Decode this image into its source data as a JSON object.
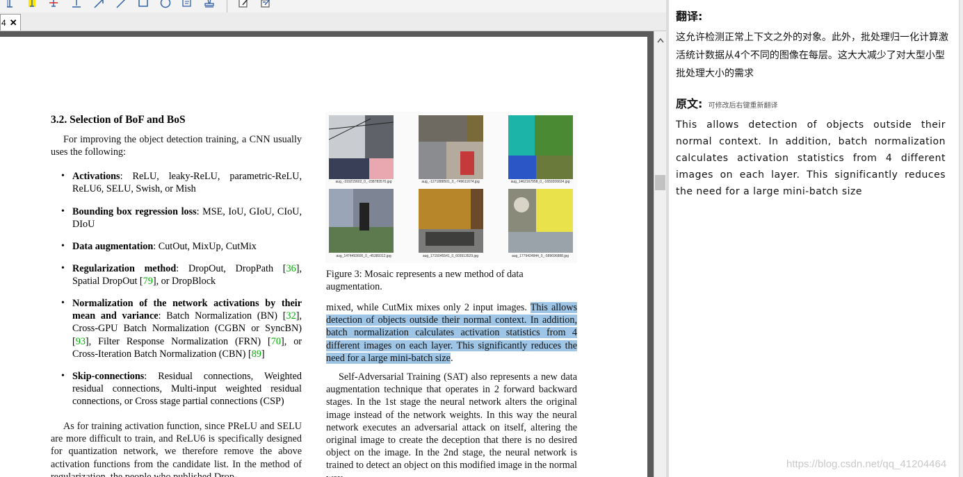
{
  "tab": {
    "label": "4",
    "close": "✕"
  },
  "doc": {
    "heading": "3.2. Selection of BoF and BoS",
    "intro": "For improving the object detection training, a CNN usually uses the following:",
    "bullets": [
      {
        "term": "Activations",
        "rest": ": ReLU, leaky-ReLU, parametric-ReLU, ReLU6, SELU, Swish, or Mish"
      },
      {
        "term": "Bounding box regression loss",
        "rest": ": MSE, IoU, GIoU, CIoU, DIoU"
      },
      {
        "term": "Data augmentation",
        "rest": ": CutOut, MixUp, CutMix"
      },
      {
        "term": "Regularization method",
        "rest_a": ": DropOut, DropPath [",
        "cite_a": "36",
        "rest_b": "], Spatial DropOut [",
        "cite_b": "79",
        "rest_c": "], or DropBlock"
      },
      {
        "term": "Normalization of the network activations by their mean and variance",
        "t1": ": Batch Normalization (BN) [",
        "c1": "32",
        "t2": "], Cross-GPU Batch Normalization (CGBN or SyncBN) [",
        "c2": "93",
        "t3": "], Filter Response Normalization (FRN) [",
        "c3": "70",
        "t4": "], or Cross-Iteration Batch Normalization (CBN) [",
        "c4": "89",
        "t5": "]"
      },
      {
        "term": "Skip-connections",
        "rest": ": Residual connections, Weighted residual connections, Multi-input weighted residual connections, or Cross stage partial connections (CSP)"
      }
    ],
    "training_para": "As for training activation function, since PReLU and SELU are more difficult to train, and ReLU6 is specifically designed for quantization network, we therefore remove the above activation functions from the candidate list. In the method of regularization, the people who published Drop-",
    "figure_caption": "Figure 3: Mosaic represents a new method of data augmentation.",
    "mosaic_captions": [
      "aug_-319215602_0_-238783570.jpg",
      "aug_-1271888501_0_-749611674.jpg",
      "aug_1462167958_0_-1659206634.jpg",
      "aug_1474493600_0_-45389312.jpg",
      "aug_1715045541_0_603913529.jpg",
      "aug_1779424844_0_-589696888.jpg"
    ],
    "right_para_pre": "mixed, while CutMix mixes only 2 input images. ",
    "right_para_hl": "This allows detection of objects outside their normal context. In addition, batch normalization calculates activation statistics from 4 different images on each layer. This significantly reduces the need for a large mini-batch size",
    "right_para_post": ".",
    "sat_para": "Self-Adversarial Training (SAT) also represents a new data augmentation technique that operates in 2 forward backward stages. In the 1st stage the neural network alters the original image instead of the network weights. In this way the neural network executes an adversarial attack on itself, altering the original image to create the deception that there is no desired object on the image. In the 2nd stage, the neural network is trained to detect an object on this modified image in the normal way."
  },
  "panel": {
    "translation_label": "翻译:",
    "translation_text": "这允许检测正常上下文之外的对象。此外，批处理归一化计算激活统计数据从4个不同的图像在每层。这大大减少了对大型小型批处理大小的需求",
    "original_label": "原文:",
    "original_hint": "可修改后右键重新翻译",
    "original_text": "This allows detection of objects outside their normal context. In addition, batch normalization calculates activation statistics from 4 different images on each layer. This significantly reduces the need for a large mini-batch size"
  },
  "watermark": "https://blog.csdn.net/qq_41204464",
  "colors": {
    "highlight": "#9ec5e6",
    "citation": "#00b000",
    "toolbar_icon": "#2f5fa8"
  }
}
